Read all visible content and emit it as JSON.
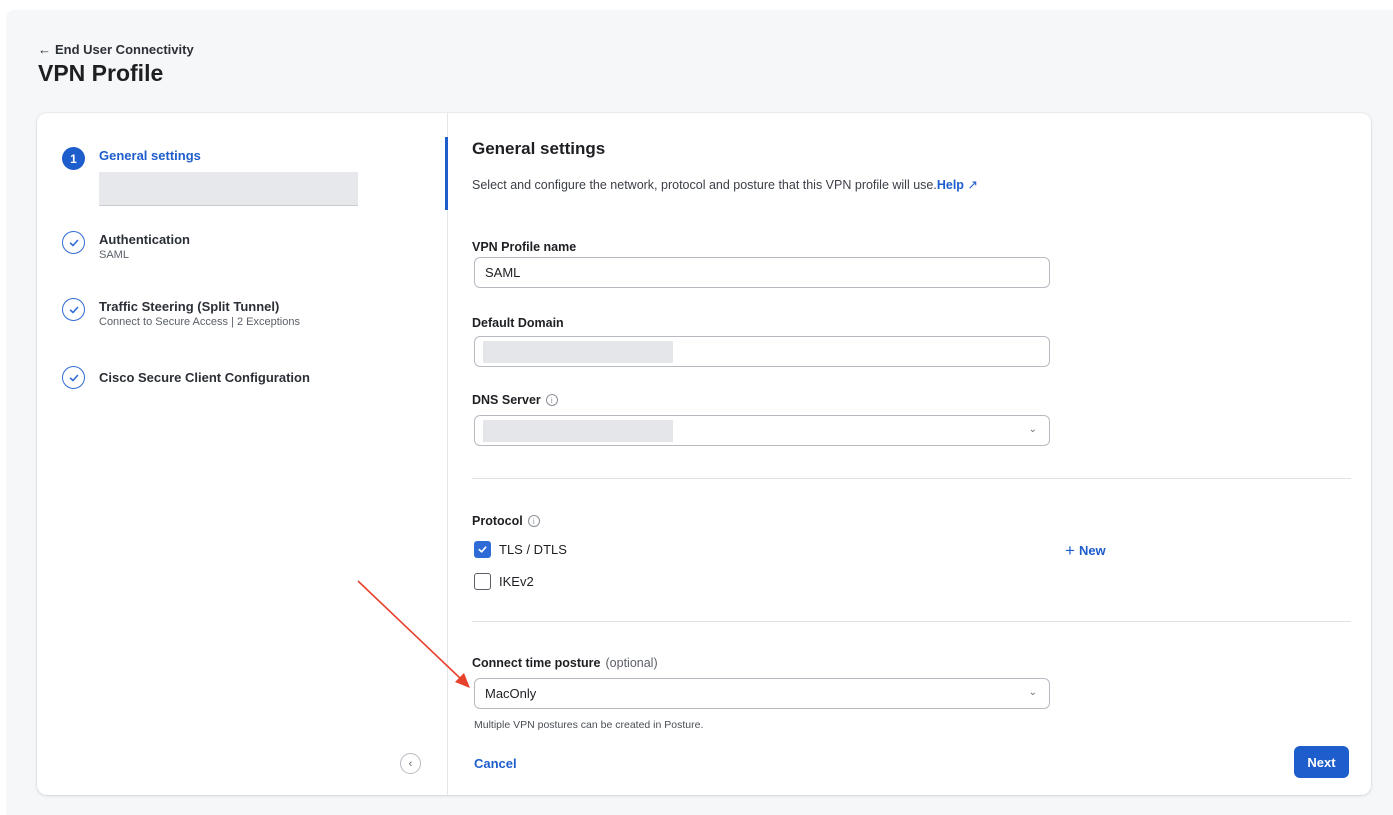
{
  "header": {
    "back_label": "End User Connectivity",
    "title": "VPN Profile"
  },
  "stepper": {
    "steps": [
      {
        "number": "1",
        "title": "General settings",
        "subtitle": "",
        "state": "active"
      },
      {
        "number": "",
        "title": "Authentication",
        "subtitle": "SAML",
        "state": "done"
      },
      {
        "number": "",
        "title": "Traffic Steering (Split Tunnel)",
        "subtitle": "Connect to Secure Access | 2 Exceptions",
        "state": "done"
      },
      {
        "number": "",
        "title": "Cisco Secure Client Configuration",
        "subtitle": "",
        "state": "done"
      }
    ],
    "collapse_icon": "chevron-left-icon"
  },
  "form": {
    "title": "General settings",
    "description": "Select and configure the network, protocol and posture that this VPN profile will use.",
    "help_label": "Help",
    "profile_name_label": "VPN Profile name",
    "profile_name_value": "SAML",
    "default_domain_label": "Default Domain",
    "default_domain_value": "",
    "dns_server_label": "DNS Server",
    "dns_server_value": "",
    "new_label": "New",
    "protocol_label": "Protocol",
    "protocols": [
      {
        "label": "TLS / DTLS",
        "checked": true
      },
      {
        "label": "IKEv2",
        "checked": false
      }
    ],
    "posture_label": "Connect time posture",
    "posture_optional": "(optional)",
    "posture_value": "MacOnly",
    "posture_hint": "Multiple VPN postures can be created in Posture.",
    "cancel_label": "Cancel",
    "next_label": "Next"
  },
  "colors": {
    "accent": "#1e5dcc",
    "annotation_arrow": "#e8412b"
  }
}
